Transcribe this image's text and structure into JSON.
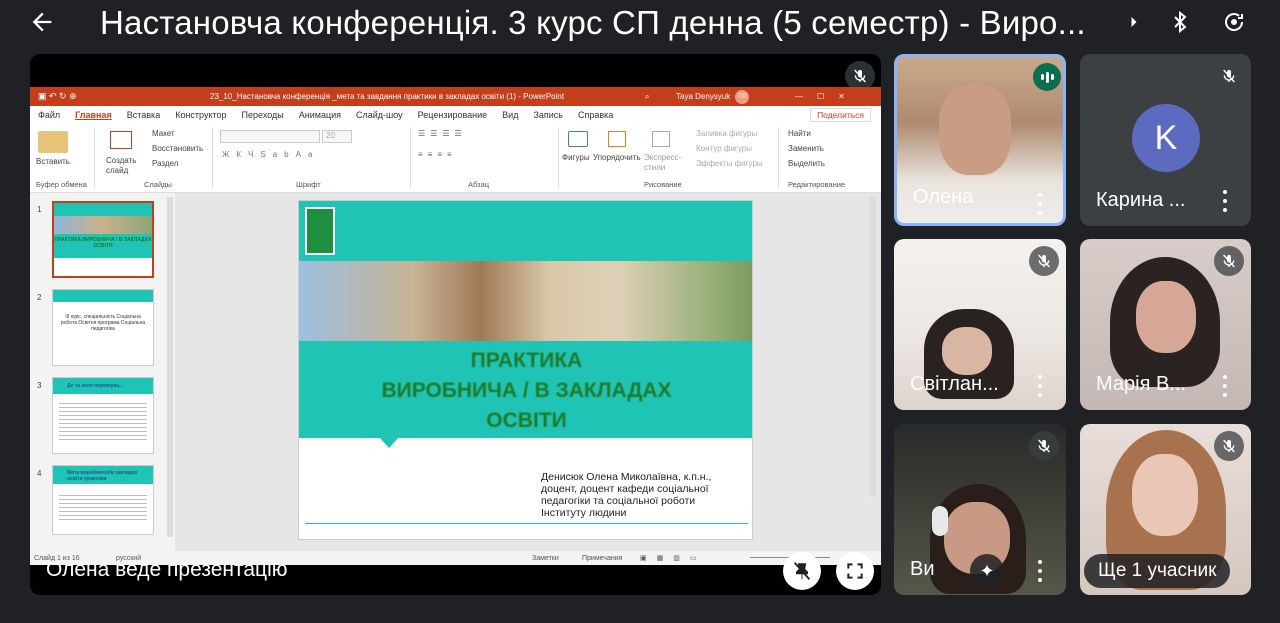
{
  "meeting": {
    "title": "Настановча конференція. 3 курс СП денна (5 семестр) - Виро...",
    "presenter_label": "Олена  веде презентацію"
  },
  "powerpoint": {
    "window_title": "23_10_Настановча конференція _мета та завдання практики в закладах освіти (1)  -  PowerPoint",
    "user_name": "Taya Denysyuk",
    "user_initials": "TD",
    "menu": [
      "Файл",
      "Главная",
      "Вставка",
      "Конструктор",
      "Переходы",
      "Анимация",
      "Слайд-шоу",
      "Рецензирование",
      "Вид",
      "Запись",
      "Справка"
    ],
    "active_menu": "Главная",
    "share_label": "Поделиться",
    "ribbon": {
      "paste": "Вставить",
      "create_slide": "Создать слайд",
      "layout": "Макет",
      "restore": "Восстановить",
      "section": "Раздел",
      "font_size": "20",
      "shapes": "Фигуры",
      "arrange": "Упорядочить",
      "express": "Экспресс-стили",
      "fill": "Заливка фигуры",
      "outline": "Контур фигуры",
      "effects": "Эффекты фигуры",
      "find": "Найти",
      "replace": "Заменить",
      "select": "Выделить",
      "groups": [
        "Буфер обмена",
        "Слайды",
        "Шрифт",
        "Абзац",
        "Рисование",
        "Редактирование"
      ]
    },
    "thumbnails": [
      {
        "num": "1",
        "text": "ПРАКТИКА ВИРОБНИЧА / В ЗАКЛАДАХ ОСВІТИ"
      },
      {
        "num": "2",
        "text": "III курс, спеціальність Соціальна робота Освітня програма Соціальна педагогіка"
      },
      {
        "num": "3",
        "text": "Де та коли перевірка..."
      },
      {
        "num": "4",
        "text": "Мета виробничої/в закладах освіти практики"
      }
    ],
    "slide": {
      "heading_line1": "ПРАКТИКА",
      "heading_line2": "ВИРОБНИЧА / В ЗАКЛАДАХ",
      "heading_line3": "ОСВІТИ",
      "author_line1": "Денисюк Олена Миколаївна, к.п.н.,",
      "author_line2": "доцент, доцент кафеди соціальної",
      "author_line3": "педагогіки та соціальної роботи",
      "author_line4": "Інституту людини"
    },
    "status": {
      "slide_counter": "Слайд 1 из 16",
      "language": "русский",
      "notes": "Заметки",
      "comments": "Примечания"
    }
  },
  "participants": [
    {
      "name": "Олена",
      "muted": false,
      "speaking": true
    },
    {
      "name": "Карина ...",
      "initial": "K",
      "muted": true
    },
    {
      "name": "Світлан...",
      "muted": true
    },
    {
      "name": "Марія В...",
      "muted": true
    },
    {
      "name": "Ви",
      "muted": true
    },
    {
      "name": "Ще 1 учасник",
      "muted": true
    }
  ],
  "colors": {
    "accent_ppt": "#c43e1c",
    "slide_teal": "#20c4b4",
    "avatar": "#5c6bc0",
    "background": "#202124"
  }
}
